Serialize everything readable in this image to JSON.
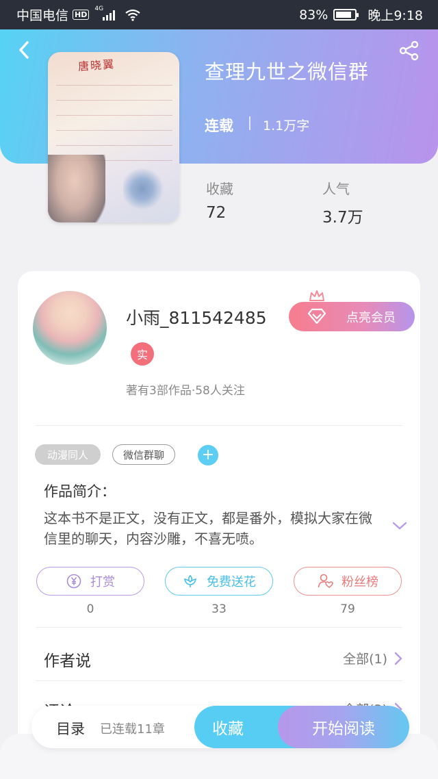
{
  "status_bar": {
    "carrier": "中国电信",
    "hd": "HD",
    "network": "4G",
    "battery": "83%",
    "battery_level": 0.83,
    "time": "晚上9:18"
  },
  "book": {
    "title": "查理九世之微信群",
    "status": "连载",
    "word_count": "1.1万字",
    "cover_text": "唐晓翼",
    "favorites_label": "收藏",
    "favorites_value": "72",
    "popularity_label": "人气",
    "popularity_value": "3.7万"
  },
  "author": {
    "name": "小雨_811542485",
    "verified_badge": "实",
    "meta": "著有3部作品·58人关注",
    "vip_button": "点亮会员"
  },
  "tags": [
    "动漫同人",
    "微信群聊"
  ],
  "tag_add": "+",
  "intro": {
    "heading": "作品简介：",
    "text": "这本书不是正文，没有正文，都是番外，模拟大家在微信里的聊天，内容沙雕，不喜无喷。"
  },
  "actions": [
    {
      "label": "打赏",
      "count": "0",
      "icon": "yen-icon"
    },
    {
      "label": "免费送花",
      "count": "33",
      "icon": "flower-icon"
    },
    {
      "label": "粉丝榜",
      "count": "79",
      "icon": "fan-heart-icon"
    }
  ],
  "author_says": {
    "title": "作者说",
    "link": "全部(1)"
  },
  "comments": {
    "title": "评论",
    "link": "全部(3)"
  },
  "bottom": {
    "toc": "目录",
    "chapters": "已连载11章",
    "favorite": "收藏",
    "read": "开始阅读"
  },
  "colors": {
    "hero_start": "#56d3f4",
    "hero_end": "#b993ec",
    "accent_blue": "#57cdf3",
    "vip_pink": "#f77d8f"
  }
}
